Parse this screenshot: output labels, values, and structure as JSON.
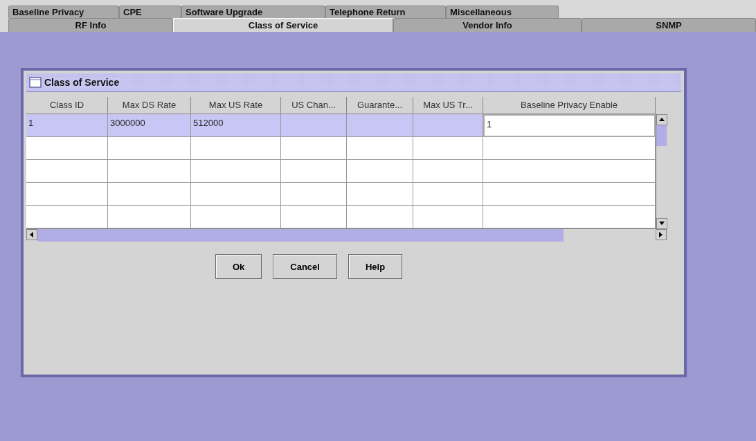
{
  "tabs_row_1": [
    {
      "label": "Baseline Privacy",
      "selected": false
    },
    {
      "label": "CPE",
      "selected": false
    },
    {
      "label": "Software Upgrade",
      "selected": false
    },
    {
      "label": "Telephone Return",
      "selected": false
    },
    {
      "label": "Miscellaneous",
      "selected": false
    }
  ],
  "tabs_row_2": [
    {
      "label": "RF Info",
      "selected": false
    },
    {
      "label": "Class of Service",
      "selected": true
    },
    {
      "label": "Vendor Info",
      "selected": false
    },
    {
      "label": "SNMP",
      "selected": false
    }
  ],
  "frame": {
    "title": "Class of Service"
  },
  "table": {
    "columns": [
      "Class ID",
      "Max DS Rate",
      "Max US Rate",
      "US Chan...",
      "Guarante...",
      "Max US Tr...",
      "Baseline Privacy Enable"
    ],
    "rows": [
      {
        "selected": true,
        "cells": [
          {
            "text": "1",
            "editing": false
          },
          {
            "text": "3000000",
            "editing": false
          },
          {
            "text": "512000",
            "editing": false
          },
          {
            "editing": false
          },
          {
            "editing": false
          },
          {
            "editing": false
          },
          {
            "text": "1",
            "editing": true
          }
        ]
      }
    ]
  },
  "buttons": [
    "Ok",
    "Cancel",
    "Help"
  ]
}
